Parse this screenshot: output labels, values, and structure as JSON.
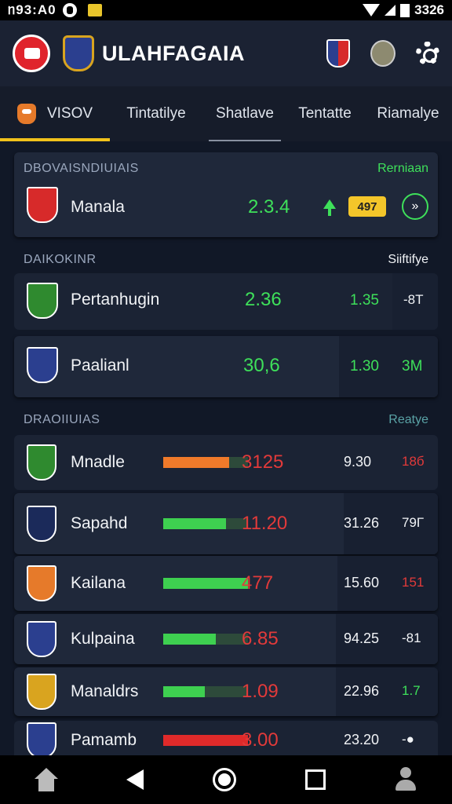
{
  "status_bar": {
    "time": "ᥒ93:A0",
    "clock_right": "3326"
  },
  "header": {
    "title": "ULAHFAGAIA"
  },
  "tabs": [
    {
      "label": "VISOV",
      "active": true
    },
    {
      "label": "Tintatilye",
      "active": false
    },
    {
      "label": "Shatlave",
      "active": false
    },
    {
      "label": "Tentatte",
      "active": false
    },
    {
      "label": "Riamalye",
      "active": false
    }
  ],
  "section1": {
    "title": "DBOVAISNDIUIAIS",
    "right": "Rerniaan",
    "row": {
      "team": "Manala",
      "value": "2.3.4",
      "chip": "497",
      "button_glyph": "»"
    }
  },
  "section2": {
    "title": "DAIKOKINR",
    "right": "Siiftifye",
    "rows": [
      {
        "team": "Pertanhugin",
        "value": "2.36",
        "odd": "1.35",
        "extra": "-8T"
      },
      {
        "team": "Paalianl",
        "value": "30,6",
        "odd": "1.30",
        "extra": "3M"
      }
    ]
  },
  "section3": {
    "title": "DRAOIIUIAS",
    "right": "Reatye",
    "rows": [
      {
        "team": "Mnadle",
        "bar_fraction": 0.78,
        "bar_color": "#f07a2a",
        "value": "3125",
        "value_color": "red",
        "odd": "9.30",
        "extra": "18б",
        "extra_color": "red"
      },
      {
        "team": "Sapahd",
        "bar_fraction": 0.74,
        "bar_color": "#3ed050",
        "value": "11.20",
        "value_color": "red",
        "odd": "31.26",
        "extra": "79Г",
        "extra_color": "white"
      },
      {
        "team": "Kailana",
        "bar_fraction": 1.0,
        "bar_color": "#3ed050",
        "value": "477",
        "value_color": "red",
        "odd": "15.60",
        "extra": "151",
        "extra_color": "red"
      },
      {
        "team": "Kulpaina",
        "bar_fraction": 0.62,
        "bar_color": "#3ed050",
        "value": "6.85",
        "value_color": "red",
        "odd": "94.25",
        "extra": "-81",
        "extra_color": "white"
      },
      {
        "team": "Manaldrs",
        "bar_fraction": 0.49,
        "bar_color": "#3ed050",
        "value": "1.09",
        "value_color": "red",
        "odd": "22.96",
        "extra": "1.7",
        "extra_color": "green"
      },
      {
        "team": "Pamamb",
        "bar_fraction": 1.0,
        "bar_color": "#e02a2a",
        "value": "3.00",
        "value_color": "red",
        "odd": "23.20",
        "extra": "-●",
        "extra_color": "white"
      }
    ]
  },
  "colors": {
    "accent": "#f1c21b",
    "positive": "#3ee05a",
    "negative": "#e23a3a"
  }
}
